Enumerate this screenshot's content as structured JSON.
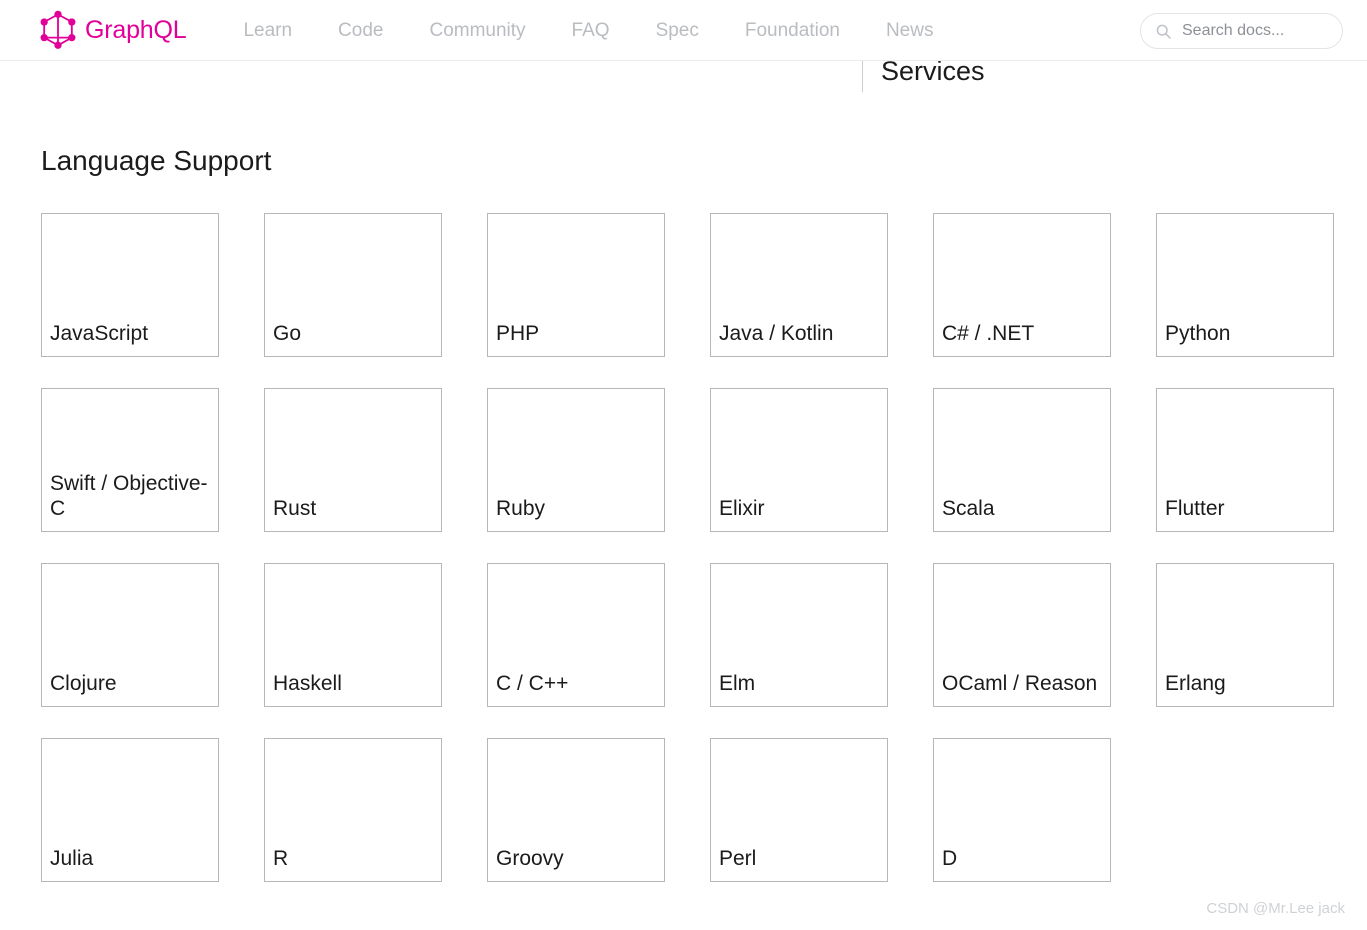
{
  "header": {
    "brand": {
      "name": "GraphQL",
      "logo_icon": "graphql-logo-icon",
      "color": "#e10098"
    },
    "nav_items": [
      {
        "label": "Learn"
      },
      {
        "label": "Code"
      },
      {
        "label": "Community"
      },
      {
        "label": "FAQ"
      },
      {
        "label": "Spec"
      },
      {
        "label": "Foundation"
      },
      {
        "label": "News"
      }
    ],
    "search": {
      "icon": "search-icon",
      "placeholder": "Search docs...",
      "value": ""
    }
  },
  "section_strip": {
    "label": "Services"
  },
  "main": {
    "title": "Language Support",
    "cards": [
      {
        "label": "JavaScript"
      },
      {
        "label": "Go"
      },
      {
        "label": "PHP"
      },
      {
        "label": "Java / Kotlin"
      },
      {
        "label": "C# / .NET"
      },
      {
        "label": "Python"
      },
      {
        "label": "Swift / Objective-C"
      },
      {
        "label": "Rust"
      },
      {
        "label": "Ruby"
      },
      {
        "label": "Elixir"
      },
      {
        "label": "Scala"
      },
      {
        "label": "Flutter"
      },
      {
        "label": "Clojure"
      },
      {
        "label": "Haskell"
      },
      {
        "label": "C / C++"
      },
      {
        "label": "Elm"
      },
      {
        "label": "OCaml / Reason"
      },
      {
        "label": "Erlang"
      },
      {
        "label": "Julia"
      },
      {
        "label": "R"
      },
      {
        "label": "Groovy"
      },
      {
        "label": "Perl"
      },
      {
        "label": "D"
      }
    ]
  },
  "watermark": {
    "text": "CSDN @Mr.Lee jack"
  }
}
